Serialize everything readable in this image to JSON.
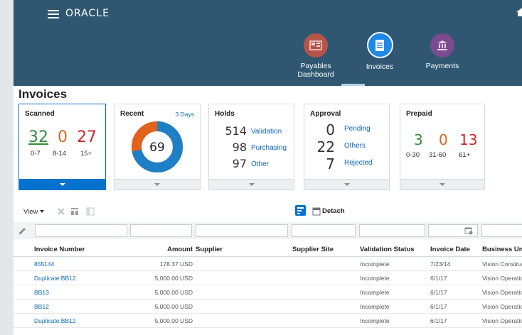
{
  "header": {
    "logo": "ORACLE",
    "nav": [
      {
        "label_line1": "Payables",
        "label_line2": "Dashboard",
        "color": "#b5554a"
      },
      {
        "label_line1": "Invoices",
        "label_line2": "",
        "color": "#1e88e5"
      },
      {
        "label_line1": "Payments",
        "label_line2": "",
        "color": "#7b4a8f"
      }
    ]
  },
  "page": {
    "title": "Invoices"
  },
  "tiles": {
    "scanned": {
      "title": "Scanned",
      "values": [
        "32",
        "0",
        "27"
      ],
      "labels": [
        "0-7",
        "8-14",
        "15+"
      ]
    },
    "recent": {
      "title": "Recent",
      "period": "3 Days",
      "center": "69",
      "blue_fraction": 0.72
    },
    "holds": {
      "title": "Holds",
      "rows": [
        {
          "count": "514",
          "label": "Validation"
        },
        {
          "count": "98",
          "label": "Purchasing"
        },
        {
          "count": "97",
          "label": "Other"
        }
      ]
    },
    "approval": {
      "title": "Approval",
      "rows": [
        {
          "count": "0",
          "label": "Pending"
        },
        {
          "count": "22",
          "label": "Others"
        },
        {
          "count": "7",
          "label": "Rejected"
        }
      ]
    },
    "prepaid": {
      "title": "Prepaid",
      "values": [
        "3",
        "0",
        "13"
      ],
      "labels": [
        "0-30",
        "31-60",
        "61+"
      ]
    }
  },
  "toolbar": {
    "view": "View",
    "detach": "Detach"
  },
  "table": {
    "columns": [
      "Invoice Number",
      "Amount",
      "Supplier",
      "Supplier Site",
      "Validation Status",
      "Invoice Date",
      "Business Un"
    ],
    "rows": [
      [
        "855144",
        "178.37 USD",
        "",
        "",
        "Incomplete",
        "7/23/14",
        "Vision Construc"
      ],
      [
        "Duplicate:BB12",
        "5,000.00 USD",
        "",
        "",
        "Incomplete",
        "6/1/17",
        "Vision Operatio"
      ],
      [
        "BB13",
        "5,000.00 USD",
        "",
        "",
        "Incomplete",
        "6/1/17",
        "Vision Operatio"
      ],
      [
        "BB12",
        "5,000.00 USD",
        "",
        "",
        "Incomplete",
        "6/1/17",
        "Vision Operatio"
      ],
      [
        "Duplicate:BB12",
        "5,000.00 USD",
        "",
        "",
        "Incomplete",
        "6/1/17",
        "Vision Operatio"
      ]
    ]
  }
}
